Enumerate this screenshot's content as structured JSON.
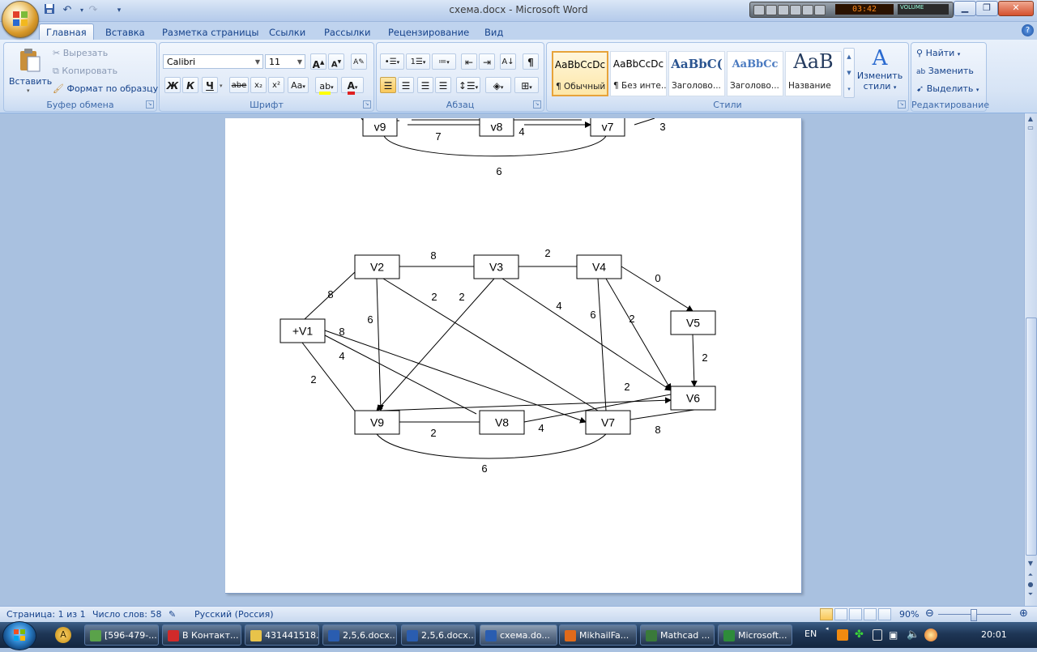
{
  "window": {
    "title": "схема.docx - Microsoft Word",
    "media_time": "03:42",
    "media_volume": "VOLUME"
  },
  "tabs": [
    {
      "label": "Главная",
      "active": true
    },
    {
      "label": "Вставка"
    },
    {
      "label": "Разметка страницы"
    },
    {
      "label": "Ссылки"
    },
    {
      "label": "Рассылки"
    },
    {
      "label": "Рецензирование"
    },
    {
      "label": "Вид"
    }
  ],
  "ribbon": {
    "clipboard": {
      "label": "Буфер обмена",
      "paste": "Вставить",
      "cut": "Вырезать",
      "copy": "Копировать",
      "format_painter": "Формат по образцу"
    },
    "font": {
      "label": "Шрифт",
      "name": "Calibri",
      "size": "11",
      "bold": "Ж",
      "italic": "К",
      "underline": "Ч",
      "strike": "abe",
      "subscript": "x₂",
      "superscript": "x²",
      "change_case": "Aa"
    },
    "paragraph": {
      "label": "Абзац"
    },
    "styles": {
      "label": "Стили",
      "items": [
        {
          "sample": "AaBbCcDc",
          "name": "¶ Обычный",
          "selected": true
        },
        {
          "sample": "AaBbCcDc",
          "name": "¶ Без инте..."
        },
        {
          "sample": "AaBbC(",
          "name": "Заголово..."
        },
        {
          "sample": "AaBbCc",
          "name": "Заголово..."
        },
        {
          "sample": "AaB",
          "name": "Название"
        }
      ],
      "change": "Изменить",
      "change2": "стили"
    },
    "editing": {
      "label": "Редактирование",
      "find": "Найти",
      "replace": "Заменить",
      "select": "Выделить"
    }
  },
  "diagram_top": {
    "nodes": [
      {
        "id": "v9",
        "label": "v9"
      },
      {
        "id": "v8",
        "label": "v8"
      },
      {
        "id": "v7",
        "label": "v7"
      }
    ],
    "edge_labels": [
      "7",
      "4",
      "3",
      "6"
    ]
  },
  "diagram": {
    "nodes": {
      "V1": "+V1",
      "V2": "V2",
      "V3": "V3",
      "V4": "V4",
      "V5": "V5",
      "V6": "V6",
      "V7": "V7",
      "V8": "V8",
      "V9": "V9"
    },
    "edges": [
      {
        "from": "V2",
        "to": "V3",
        "weight": "8"
      },
      {
        "from": "V3",
        "to": "V4",
        "weight": "2"
      },
      {
        "from": "V4",
        "to": "V5",
        "weight": "0",
        "arrow": true
      },
      {
        "from": "V1",
        "to": "V2",
        "weight": "8"
      },
      {
        "from": "V2",
        "to": "V9",
        "weight": "6",
        "arrow": true
      },
      {
        "from": "V2",
        "to": "V7",
        "weight": "2"
      },
      {
        "from": "V3",
        "to": "V9",
        "weight": "2",
        "arrow": true
      },
      {
        "from": "V3",
        "to": "V6",
        "weight": "4",
        "arrow": true
      },
      {
        "from": "V4",
        "to": "V7",
        "weight": "6"
      },
      {
        "from": "V4",
        "to": "V6",
        "weight": "2",
        "arrow": true
      },
      {
        "from": "V5",
        "to": "V6",
        "weight": "2",
        "arrow": true
      },
      {
        "from": "V1",
        "to": "V7",
        "weight": "8",
        "arrow": true
      },
      {
        "from": "V1",
        "to": "V8",
        "weight": "4"
      },
      {
        "from": "V1",
        "to": "V9",
        "weight": "2"
      },
      {
        "from": "V9",
        "to": "V6",
        "weight": "2",
        "arrow": true
      },
      {
        "from": "V9",
        "to": "V8",
        "weight": "2"
      },
      {
        "from": "V8",
        "to": "V6",
        "weight": "4"
      },
      {
        "from": "V7",
        "to": "V6",
        "weight": "8"
      },
      {
        "from": "V9",
        "to": "V7",
        "weight": "6",
        "curved": true
      }
    ]
  },
  "status": {
    "page": "Страница: 1 из 1",
    "words": "Число слов: 58",
    "language": "Русский (Россия)",
    "zoom": "90%"
  },
  "taskbar": {
    "items": [
      {
        "label": "[596-479-...",
        "color": "#5aa24a"
      },
      {
        "label": "В Контакт...",
        "color": "#d12a2a"
      },
      {
        "label": "431441518...",
        "color": "#e8c34a"
      },
      {
        "label": "2,5,6.docx...",
        "color": "#2a5db0"
      },
      {
        "label": "2,5,6.docx...",
        "color": "#2a5db0"
      },
      {
        "label": "схема.do...",
        "color": "#2a5db0",
        "active": true
      },
      {
        "label": "MikhailFa...",
        "color": "#e06a1a"
      },
      {
        "label": "Mathcad ...",
        "color": "#3a7a3a"
      },
      {
        "label": "Microsoft...",
        "color": "#2e8b3a"
      }
    ],
    "lang": "EN",
    "clock": "20:01"
  }
}
